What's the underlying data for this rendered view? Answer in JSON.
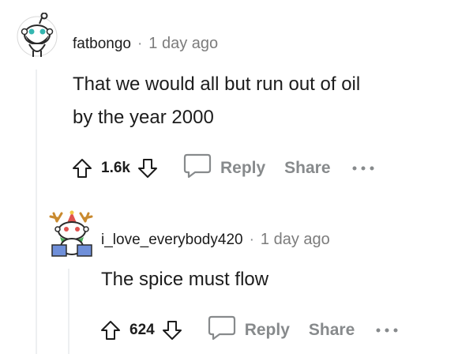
{
  "comments": [
    {
      "username": "fatbongo",
      "separator": "·",
      "time": "1 day ago",
      "body_lines": [
        "That we would all but run out of oil",
        "by the year 2000"
      ],
      "score": "1.6k",
      "reply_label": "Reply",
      "share_label": "Share",
      "avatar_icon": "snoo-bearded-avatar-icon"
    },
    {
      "username": "i_love_everybody420",
      "separator": "·",
      "time": "1 day ago",
      "body_lines": [
        "The spice must flow"
      ],
      "score": "624",
      "reply_label": "Reply",
      "share_label": "Share",
      "avatar_icon": "snoo-reindeer-avatar-icon"
    }
  ],
  "icons": {
    "upvote": "upvote-arrow-icon",
    "downvote": "downvote-arrow-icon",
    "reply": "speech-bubble-icon",
    "more": "more-options-icon"
  },
  "colors": {
    "text": "#1c1c1c",
    "meta": "#7c7c7c",
    "action": "#878a8c",
    "thread_line": "#edeff1"
  }
}
